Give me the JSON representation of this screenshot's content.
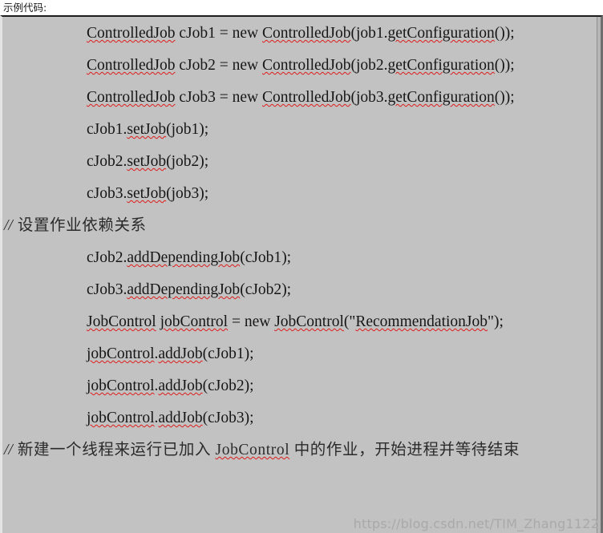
{
  "heading": "示例代码:",
  "code": {
    "lines": [
      {
        "id": "line-1",
        "text": "ControlledJob cJob1 = new ControlledJob(job1.getConfiguration());",
        "kind": "stmt",
        "spacing": "first"
      },
      {
        "id": "line-2",
        "text": "ControlledJob cJob2 = new ControlledJob(job2.getConfiguration());",
        "kind": "stmt",
        "spacing": "gap"
      },
      {
        "id": "line-3",
        "text": "ControlledJob cJob3 = new ControlledJob(job3.getConfiguration());",
        "kind": "stmt",
        "spacing": "gap"
      },
      {
        "id": "line-4",
        "text": "cJob1.setJob(job1);",
        "kind": "stmt",
        "spacing": "gap"
      },
      {
        "id": "line-5",
        "text": "cJob2.setJob(job2);",
        "kind": "stmt",
        "spacing": "gap"
      },
      {
        "id": "line-6",
        "text": "cJob3.setJob(job3);",
        "kind": "stmt",
        "spacing": "gap"
      },
      {
        "id": "line-7",
        "text": "设置作业依赖关系",
        "kind": "comment",
        "spacing": "gap",
        "marker": "//"
      },
      {
        "id": "line-8",
        "text": "cJob2.addDependingJob(cJob1);",
        "kind": "stmt",
        "spacing": "gap"
      },
      {
        "id": "line-9",
        "text": "cJob3.addDependingJob(cJob2);",
        "kind": "stmt",
        "spacing": "gap"
      },
      {
        "id": "line-10",
        "text": "JobControl jobControl = new JobControl(\"RecommendationJob\");",
        "kind": "stmt",
        "spacing": "gap"
      },
      {
        "id": "line-11",
        "text": "jobControl.addJob(cJob1);",
        "kind": "stmt",
        "spacing": "gap"
      },
      {
        "id": "line-12",
        "text": "jobControl.addJob(cJob2);",
        "kind": "stmt",
        "spacing": "gap"
      },
      {
        "id": "line-13",
        "text": "jobControl.addJob(cJob3);",
        "kind": "stmt",
        "spacing": "gap"
      },
      {
        "id": "line-14",
        "text": "新建一个线程来运行已加入 JobControl 中的作业，开始进程并等待结束",
        "kind": "comment",
        "spacing": "gap",
        "marker": "//"
      }
    ]
  },
  "watermark": "https://blog.csdn.net/TIM_Zhang1122",
  "colors": {
    "code_background": "#c2c2c2",
    "page_background": "#ffffff",
    "text": "#161616",
    "spellcheck_underline": "#e01b1b",
    "watermark": "#a9a9a9"
  }
}
